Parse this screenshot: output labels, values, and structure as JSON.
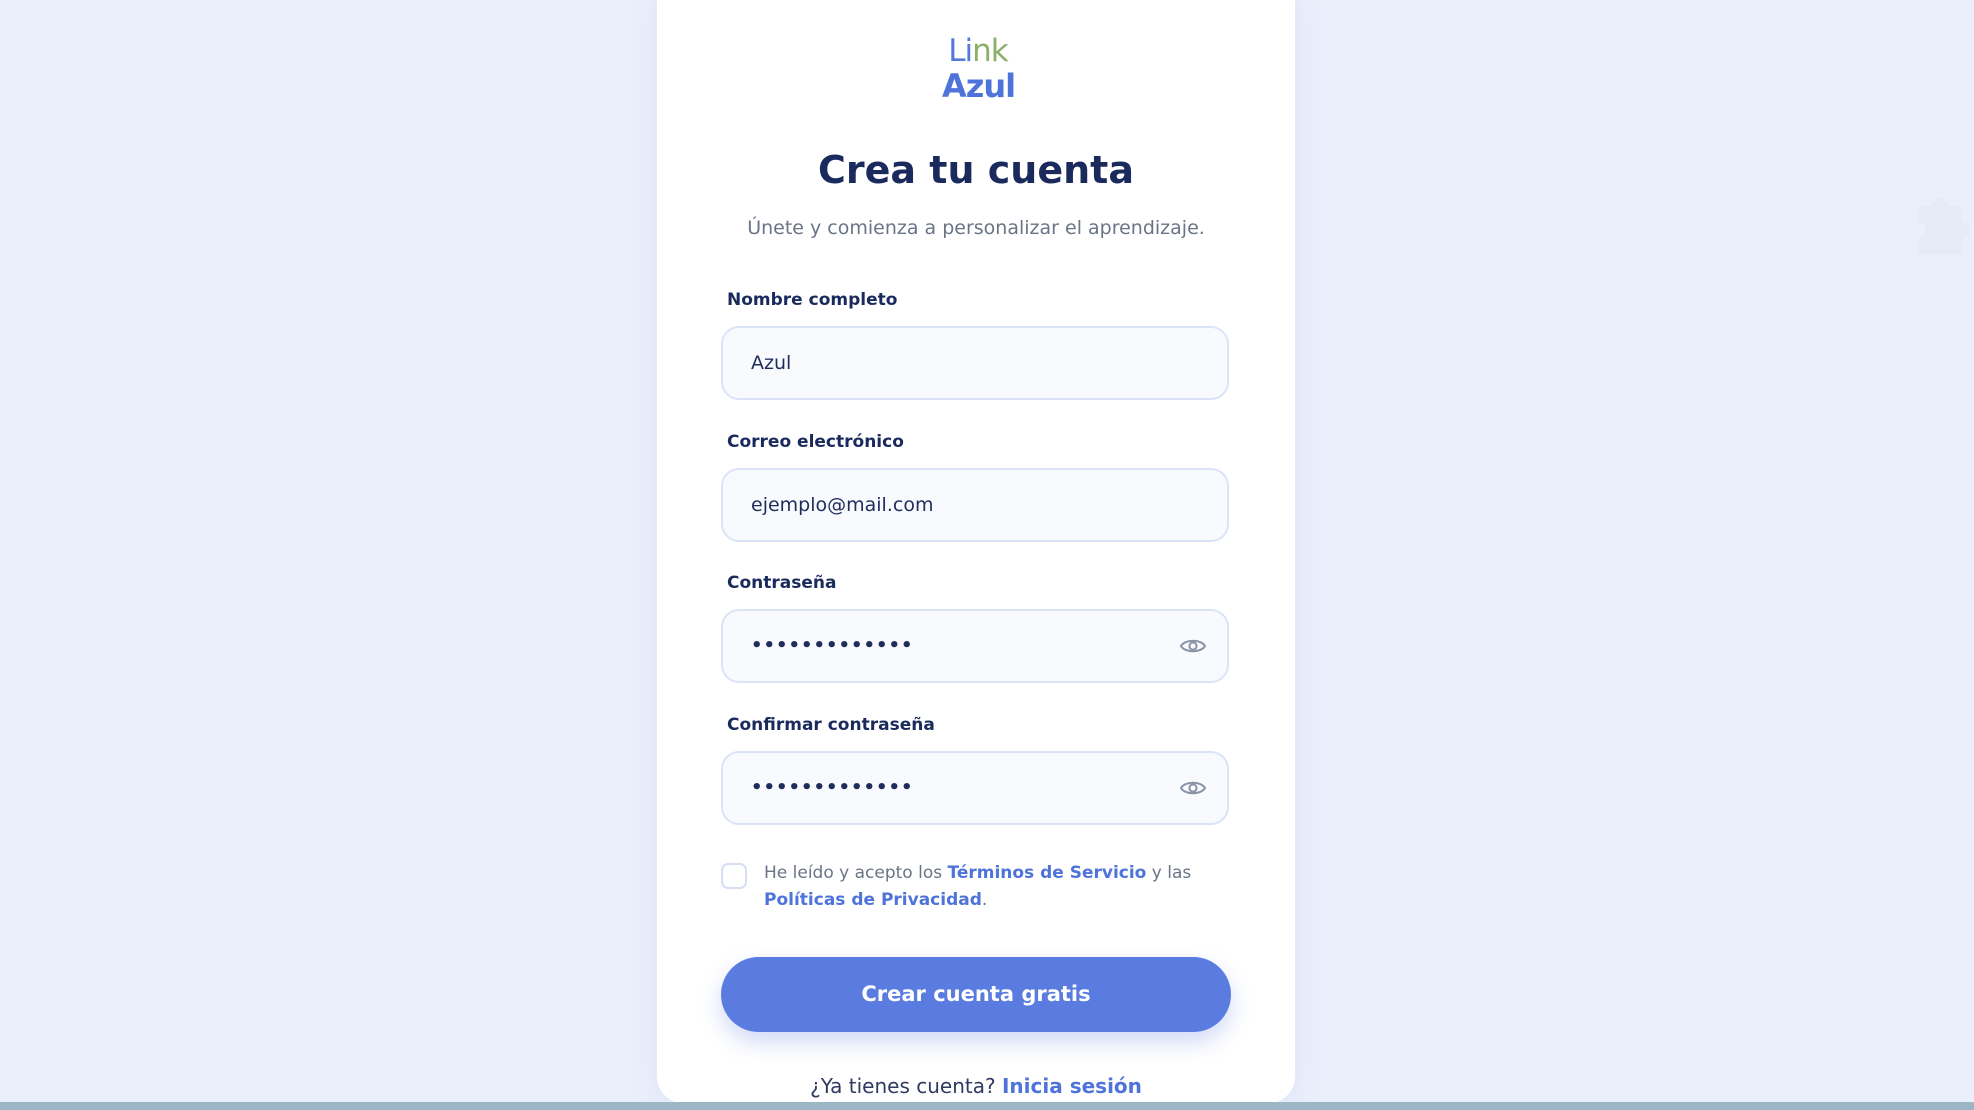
{
  "brand": {
    "logo_line1_a": "Li",
    "logo_line1_b": "nk",
    "logo_line2": "Azul"
  },
  "header": {
    "title": "Crea tu cuenta",
    "subtitle": "Únete y comienza a personalizar el aprendizaje."
  },
  "form": {
    "name": {
      "label": "Nombre completo",
      "value": "Azul"
    },
    "email": {
      "label": "Correo electrónico",
      "value": "ejemplo@mail.com"
    },
    "password": {
      "label": "Contraseña",
      "masked_value": "•••••••••••••"
    },
    "confirm_password": {
      "label": "Confirmar contraseña",
      "masked_value": "•••••••••••••"
    },
    "terms": {
      "checked": false,
      "text_before": "He leído y acepto los ",
      "terms_link": "Términos de Servicio",
      "text_middle": " y las",
      "privacy_link": "Políticas de Privacidad",
      "text_after": "."
    },
    "submit_label": "Crear cuenta gratis"
  },
  "footer": {
    "prompt": "¿Ya tienes cuenta?",
    "login_link": "Inicia sesión"
  },
  "colors": {
    "background": "#ebeffc",
    "primary": "#5a7be0",
    "link": "#4e73da",
    "heading": "#1a2a5c",
    "logo_green": "#8ab06a"
  },
  "icons": {
    "password_toggle": "eye-icon",
    "decoration": "puzzle-icon"
  }
}
